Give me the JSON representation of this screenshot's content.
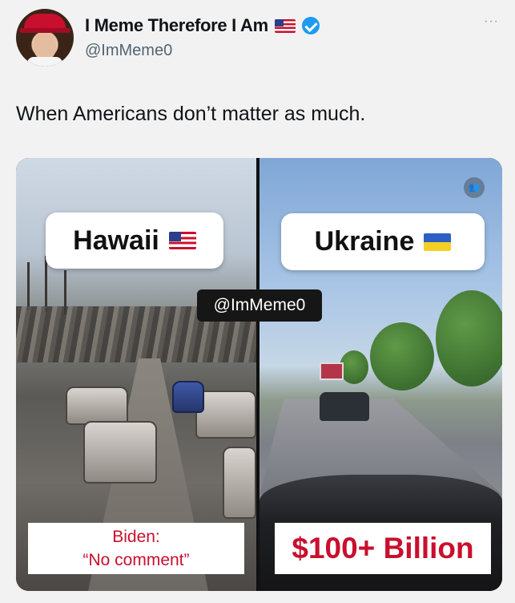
{
  "post": {
    "display_name": "I Meme Therefore I Am",
    "handle": "@ImMeme0",
    "more_label": "···",
    "text": "When Americans don’t matter as much."
  },
  "media": {
    "left_label": "Hawaii",
    "right_label": "Ukraine",
    "watermark_handle": "@ImMeme0",
    "left_caption_line1": "Biden:",
    "left_caption_line2": "“No comment”",
    "right_caption": "$100+ Billion",
    "corner_watermark": "👥"
  },
  "colors": {
    "verified": "#1d9bf0",
    "caption_red": "#c8102e",
    "text_primary": "#0f1419",
    "text_secondary": "#536471"
  },
  "icons": [
    "avatar",
    "us-flag-icon",
    "verified-badge-icon",
    "more-options-icon",
    "ukraine-flag-icon",
    "watermark-icon"
  ]
}
